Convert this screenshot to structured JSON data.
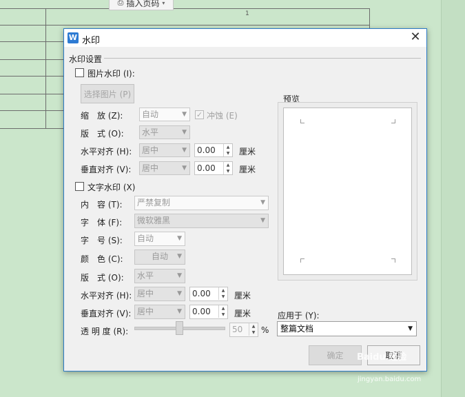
{
  "background_doc": {
    "insert_page_number": "插入页码",
    "page_number": "1"
  },
  "dialog": {
    "title": "水印",
    "section_title": "水印设置",
    "picture_watermark": {
      "checkbox_label": "图片水印 (I):",
      "select_picture": "选择图片 (P)",
      "scale_label": "缩　放 (Z):",
      "scale_value": "自动",
      "washout_label": "冲蚀 (E)",
      "layout_label": "版　式 (O):",
      "layout_value": "水平",
      "halign_label": "水平对齐 (H):",
      "halign_value": "居中",
      "halign_offset": "0.00",
      "valign_label": "垂直对齐 (V):",
      "valign_value": "居中",
      "valign_offset": "0.00",
      "unit": "厘米"
    },
    "text_watermark": {
      "checkbox_label": "文字水印 (X)",
      "content_label": "内　容 (T):",
      "content_value": "严禁复制",
      "font_label": "字　体 (F):",
      "font_value": "微软雅黑",
      "size_label": "字　号 (S):",
      "size_value": "自动",
      "color_label": "颜　色 (C):",
      "color_value": "自动",
      "layout_label": "版　式 (O):",
      "layout_value": "水平",
      "halign_label": "水平对齐 (H):",
      "halign_value": "居中",
      "halign_offset": "0.00",
      "valign_label": "垂直对齐 (V):",
      "valign_value": "居中",
      "valign_offset": "0.00",
      "unit": "厘米",
      "transparency_label": "透 明 度 (R):",
      "transparency_value": "50",
      "transparency_unit": "%"
    },
    "preview_label": "预览",
    "apply_to_label": "应用于 (Y):",
    "apply_to_value": "整篇文档",
    "ok_button": "确定",
    "cancel_button": "取消"
  },
  "watermark_logo": {
    "brand": "Baidu 经验",
    "url": "jingyan.baidu.com"
  },
  "colors": {
    "doc_background": "#cfe8cf",
    "dialog_border": "#2b79c6",
    "app_icon": "#2d7bd3"
  }
}
